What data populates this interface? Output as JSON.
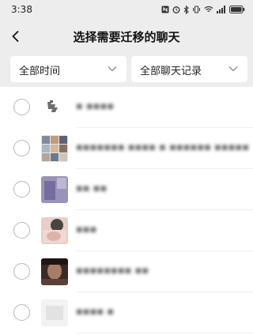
{
  "status_bar": {
    "time": "3:38",
    "icons": [
      "nfc-icon",
      "alarm-icon",
      "bluetooth-icon",
      "vibrate-icon",
      "wifi-icon",
      "signal-icon",
      "battery-icon"
    ]
  },
  "nav": {
    "title": "选择需要迁移的聊天"
  },
  "filters": {
    "time_filter": "全部时间",
    "content_filter": "全部聊天记录"
  },
  "chats": [
    {
      "name": "▪ ▪▪▪▪"
    },
    {
      "name": "▪▪▪▪▪▪▪ ▪▪▪▪ ▪ ▪▪▪▪▪▪ ▪▪▪▪▪…"
    },
    {
      "name": "▪▪ ▪▪"
    },
    {
      "name": "▪▪▪"
    },
    {
      "name": "▪▪▪▪▪▪▪▪ ▪▪"
    },
    {
      "name": "▪▪▪▪ ▪"
    }
  ],
  "colors": {
    "header_bg": "#ededed",
    "list_bg": "#ffffff",
    "radio_border": "#b8b8b8"
  }
}
